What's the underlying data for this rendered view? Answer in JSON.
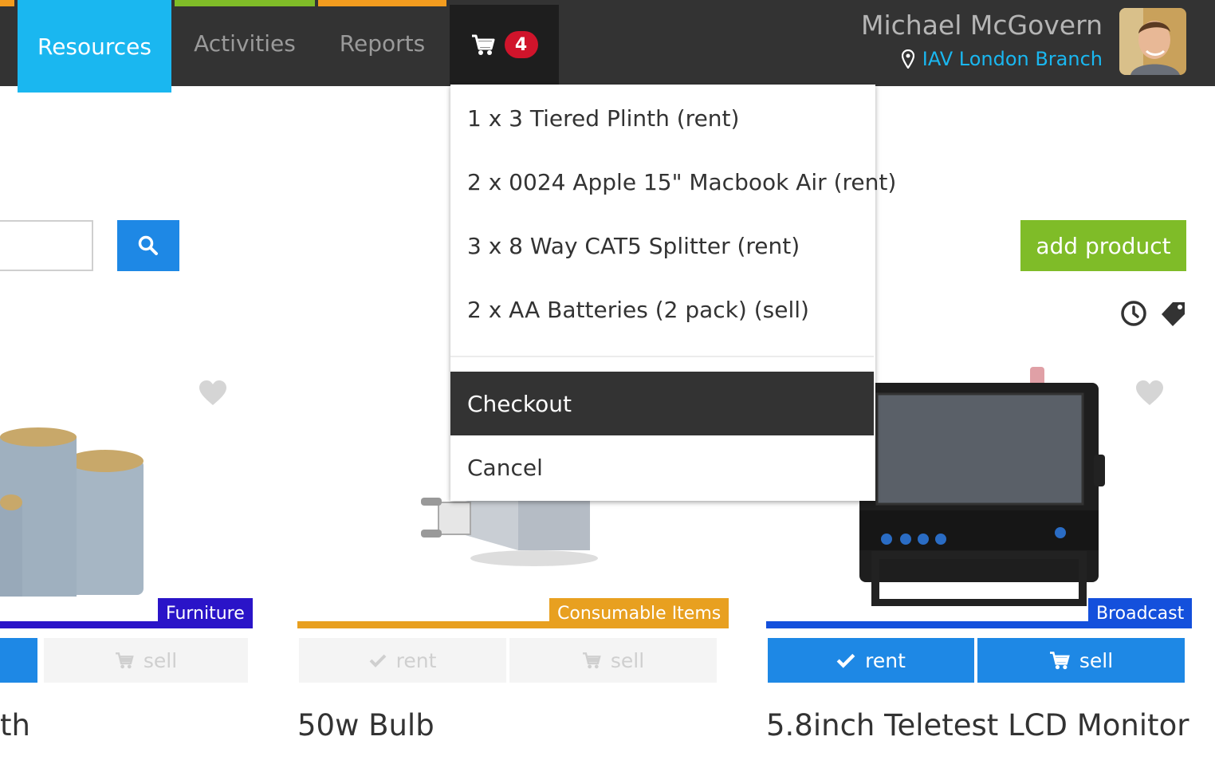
{
  "nav": {
    "tabs": [
      {
        "label": "Resources"
      },
      {
        "label": "Activities"
      },
      {
        "label": "Reports"
      }
    ],
    "cart_count": "4"
  },
  "user": {
    "name": "Michael McGovern",
    "branch": "IAV London Branch"
  },
  "toolbar": {
    "add_product_label": "add product"
  },
  "cart_dropdown": {
    "items": [
      "1 x 3 Tiered Plinth (rent)",
      "2 x 0024 Apple 15\" Macbook Air (rent)",
      "3 x 8 Way CAT5 Splitter (rent)",
      "2 x AA Batteries (2 pack) (sell)"
    ],
    "checkout_label": "Checkout",
    "cancel_label": "Cancel"
  },
  "products": [
    {
      "title": "th",
      "category": "Furniture",
      "category_color": "#2a14c8",
      "sell_label": "sell"
    },
    {
      "title": "50w Bulb",
      "category": "Consumable Items",
      "category_color": "#e8a020",
      "rent_label": "rent",
      "sell_label": "sell"
    },
    {
      "title": "5.8inch Teletest LCD Monitor",
      "category": "Broadcast",
      "category_color": "#1450dc",
      "rent_label": "rent",
      "sell_label": "sell"
    }
  ],
  "colors": {
    "accent": "#1ab7f0",
    "primary_button": "#1e88e5",
    "add_button": "#7fbc28",
    "badge": "#d0142b"
  }
}
